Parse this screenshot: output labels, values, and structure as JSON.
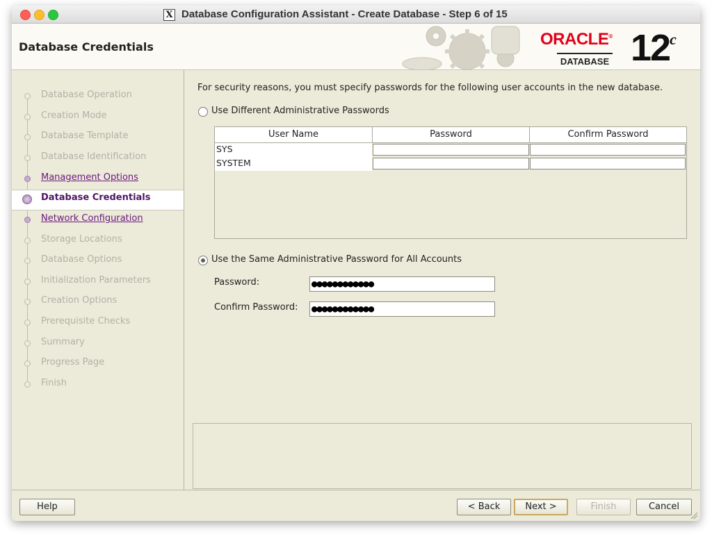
{
  "window": {
    "title": "Database Configuration Assistant - Create Database - Step 6 of 15",
    "x_icon": "X"
  },
  "header": {
    "title": "Database Credentials",
    "logo_brand": "ORACLE",
    "logo_sub": "DATABASE",
    "logo_version": "12",
    "logo_version_sup": "c"
  },
  "sidebar": {
    "steps": [
      {
        "label": "Database Operation",
        "state": "disabled"
      },
      {
        "label": "Creation Mode",
        "state": "disabled"
      },
      {
        "label": "Database Template",
        "state": "disabled"
      },
      {
        "label": "Database Identification",
        "state": "disabled"
      },
      {
        "label": "Management Options",
        "state": "link"
      },
      {
        "label": "Database Credentials",
        "state": "active"
      },
      {
        "label": "Network Configuration",
        "state": "link"
      },
      {
        "label": "Storage Locations",
        "state": "disabled"
      },
      {
        "label": "Database Options",
        "state": "disabled"
      },
      {
        "label": "Initialization Parameters",
        "state": "disabled"
      },
      {
        "label": "Creation Options",
        "state": "disabled"
      },
      {
        "label": "Prerequisite Checks",
        "state": "disabled"
      },
      {
        "label": "Summary",
        "state": "disabled"
      },
      {
        "label": "Progress Page",
        "state": "disabled"
      },
      {
        "label": "Finish",
        "state": "disabled"
      }
    ]
  },
  "main": {
    "intro": "For security reasons, you must specify passwords for the following user accounts in the new database.",
    "option_different": {
      "label": "Use Different Administrative Passwords",
      "selected": false
    },
    "table": {
      "headers": [
        "User Name",
        "Password",
        "Confirm Password"
      ],
      "rows": [
        {
          "user": "SYS"
        },
        {
          "user": "SYSTEM"
        }
      ]
    },
    "option_same": {
      "label": "Use the Same Administrative Password for All Accounts",
      "selected": true
    },
    "password_label": "Password:",
    "password_value": "●●●●●●●●●●●●",
    "confirm_label": "Confirm Password:",
    "confirm_value": "●●●●●●●●●●●●"
  },
  "footer": {
    "help": "Help",
    "back": "< Back",
    "next": "Next >",
    "finish": "Finish",
    "cancel": "Cancel"
  }
}
